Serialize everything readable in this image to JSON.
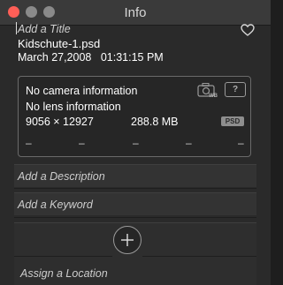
{
  "window": {
    "title": "Info"
  },
  "fields": {
    "title_placeholder": "Add a Title",
    "filename": "Kidschute-1.psd",
    "date": "March 27,2008",
    "time": "01:31:15 PM"
  },
  "metadata": {
    "camera": "No camera information",
    "lens": "No lens information",
    "dimensions": "9056 × 12927",
    "file_size": "288.8 MB",
    "format_badge": "PSD",
    "help_label": "?",
    "exif_values": [
      "–",
      "–",
      "–",
      "–",
      "–"
    ]
  },
  "sections": {
    "description_placeholder": "Add a Description",
    "keyword_placeholder": "Add a Keyword",
    "location_placeholder": "Assign a Location"
  },
  "icons": {
    "favorite": "heart-icon",
    "camera_wb": "camera-wb-icon",
    "help": "help-icon",
    "add": "plus-icon"
  },
  "colors": {
    "close": "#ff5f57",
    "background": "#2a2a2a",
    "text": "#ffffff"
  }
}
